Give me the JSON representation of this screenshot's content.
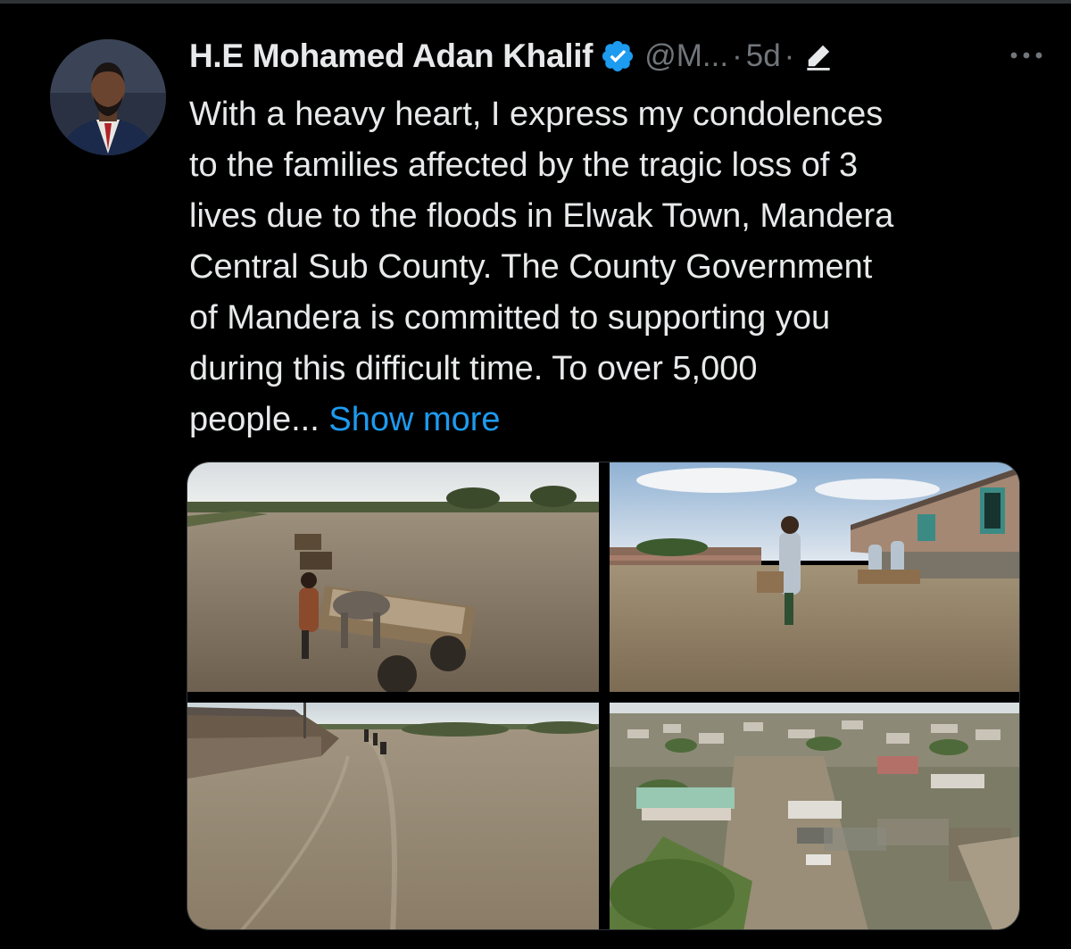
{
  "author": {
    "display_name": "H.E Mohamed Adan Khalif",
    "handle": "@M...",
    "separator": "·",
    "time": "5d",
    "separator2": "·"
  },
  "tweet": {
    "body": "With a heavy heart, I express my condolences\nto the families affected by the tragic loss of 3\nlives due to the floods in Elwak Town, Mandera\nCentral Sub County. The County Government\nof Mandera is committed to supporting you\nduring this difficult time. To over 5,000\npeople... ",
    "show_more": "Show more"
  },
  "icons": {
    "verified": "verified-badge-icon",
    "edit": "edited-icon",
    "more": "more-options-icon"
  },
  "colors": {
    "background": "#000000",
    "text": "#e7e9ea",
    "muted": "#71767b",
    "link": "#1d9bf0",
    "verified": "#1d9bf0"
  },
  "media": [
    {
      "description_icon": "flood-donkey-cart-photo"
    },
    {
      "description_icon": "flood-children-carrying-desks-photo"
    },
    {
      "description_icon": "flooded-road-people-wading-photo"
    },
    {
      "description_icon": "flooded-town-aerial-photo"
    }
  ]
}
